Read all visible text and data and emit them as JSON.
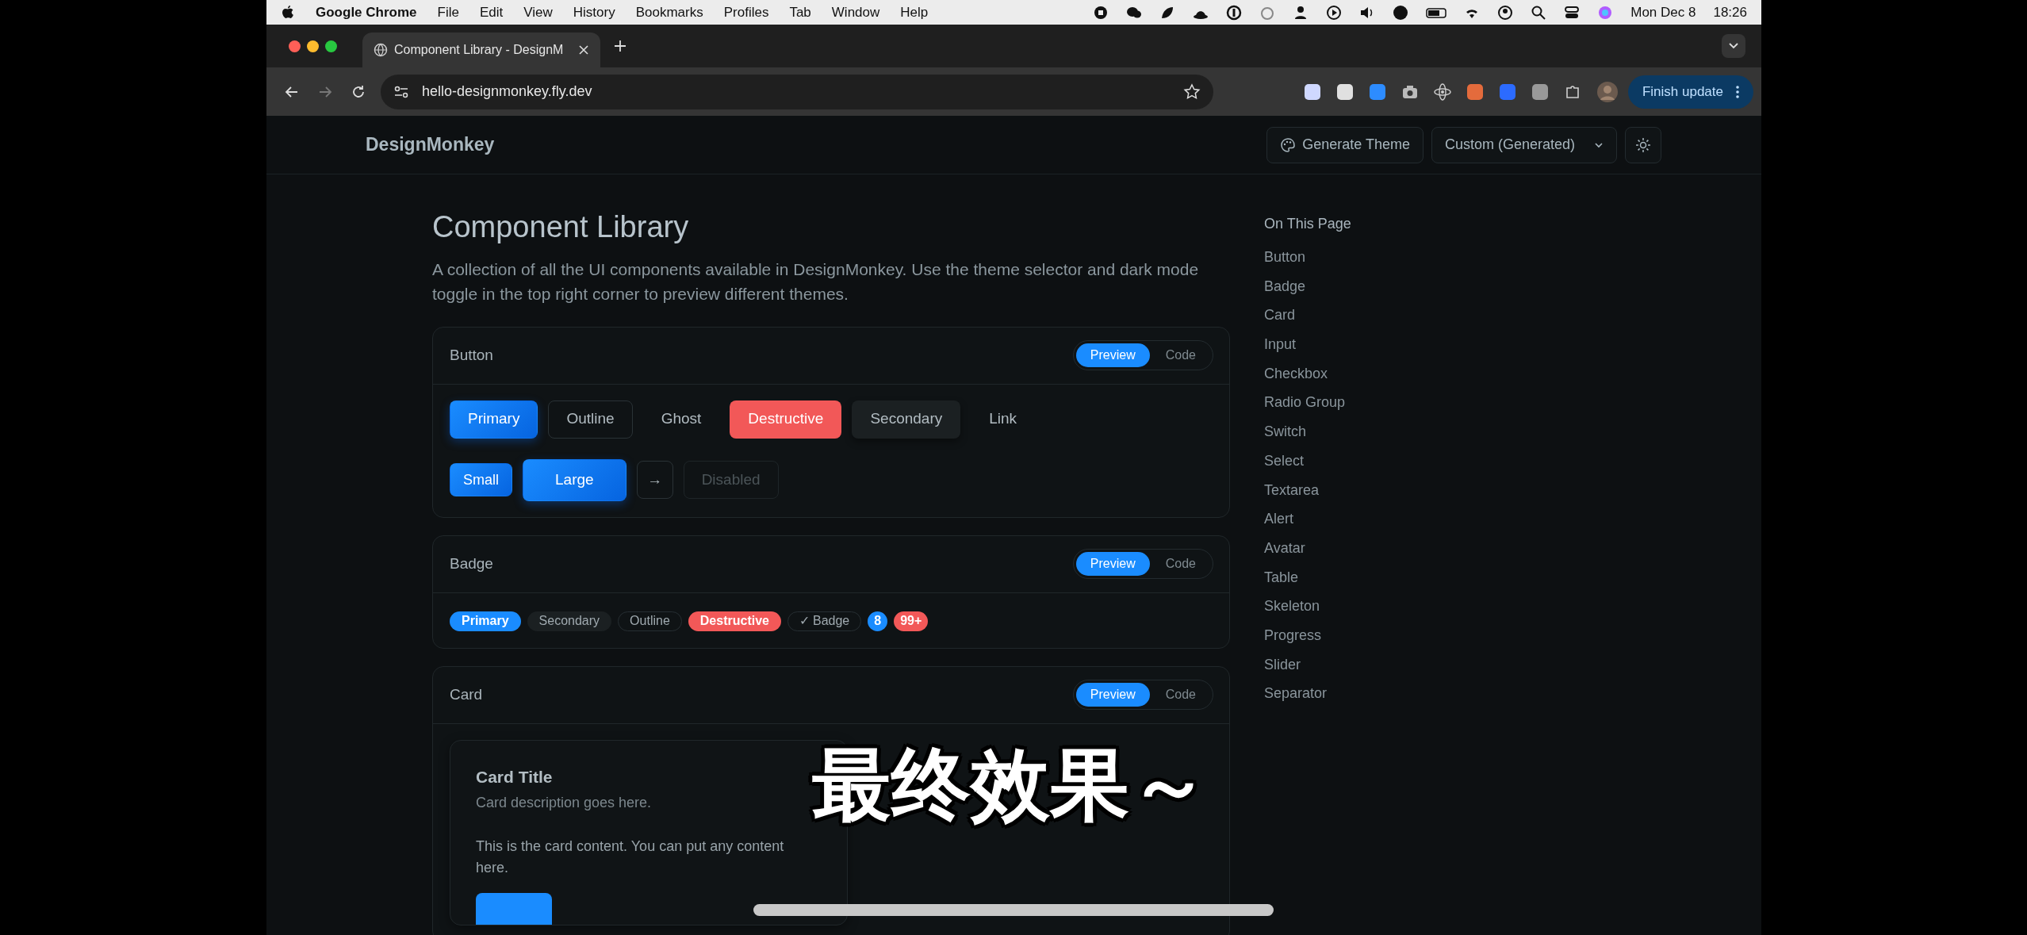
{
  "menu_bar": {
    "app": "Google Chrome",
    "menus": [
      "File",
      "Edit",
      "View",
      "History",
      "Bookmarks",
      "Profiles",
      "Tab",
      "Window",
      "Help"
    ],
    "date": "Mon Dec 8",
    "time": "18:26"
  },
  "browser": {
    "tabs": [
      {
        "title": "Component Library - DesignM",
        "selected": true
      }
    ],
    "url": "hello-designmonkey.fly.dev",
    "update_button": "Finish update"
  },
  "header": {
    "brand": "DesignMonkey",
    "generate_button": "Generate Theme",
    "theme_select": "Custom (Generated)"
  },
  "page": {
    "title": "Component Library",
    "description": "A collection of all the UI components available in DesignMonkey. Use the theme selector and dark mode toggle in the top right corner to preview different themes."
  },
  "sections": [
    {
      "title": "Button",
      "kind": "buttons",
      "toggle": [
        {
          "label": "Preview",
          "selected": true
        },
        {
          "label": "Code",
          "selected": false
        }
      ],
      "rows": [
        [
          {
            "label": "Primary",
            "kind": "primary",
            "disabled": false
          },
          {
            "label": "Outline",
            "kind": "outline",
            "disabled": false
          },
          {
            "label": "Ghost",
            "kind": "ghost",
            "disabled": false
          },
          {
            "label": "Destructive",
            "kind": "destructive",
            "disabled": false
          },
          {
            "label": "Secondary",
            "kind": "secondary",
            "disabled": false
          },
          {
            "label": "Link",
            "kind": "link",
            "disabled": false
          }
        ],
        [
          {
            "label": "Small",
            "kind": "small",
            "disabled": false
          },
          {
            "label": "Large",
            "kind": "large",
            "disabled": false
          },
          {
            "label": "→",
            "kind": "icon",
            "disabled": false
          },
          {
            "label": "Disabled",
            "kind": "outline",
            "disabled": true
          }
        ]
      ]
    },
    {
      "title": "Badge",
      "kind": "badges",
      "toggle": [
        {
          "label": "Preview",
          "selected": true
        },
        {
          "label": "Code",
          "selected": false
        }
      ],
      "badges": [
        {
          "label": "Primary",
          "kind": "primary"
        },
        {
          "label": "Secondary",
          "kind": "secondary"
        },
        {
          "label": "Outline",
          "kind": "outline"
        },
        {
          "label": "Destructive",
          "kind": "destructive"
        },
        {
          "label": "Badge",
          "icon": "✓",
          "kind": "outline"
        },
        {
          "label": "8",
          "kind": "count"
        },
        {
          "label": "99+",
          "kind": "alert"
        }
      ]
    },
    {
      "title": "Card",
      "kind": "card",
      "toggle": [
        {
          "label": "Preview",
          "selected": true
        },
        {
          "label": "Code",
          "selected": false
        }
      ],
      "card": {
        "title": "Card Title",
        "description": "Card description goes here.",
        "content": "This is the card content. You can put any content here."
      }
    }
  ],
  "toc": {
    "title": "On This Page",
    "items": [
      "Button",
      "Badge",
      "Card",
      "Input",
      "Checkbox",
      "Radio Group",
      "Switch",
      "Select",
      "Textarea",
      "Alert",
      "Avatar",
      "Table",
      "Skeleton",
      "Progress",
      "Slider",
      "Separator"
    ]
  },
  "caption": "最终效果～"
}
